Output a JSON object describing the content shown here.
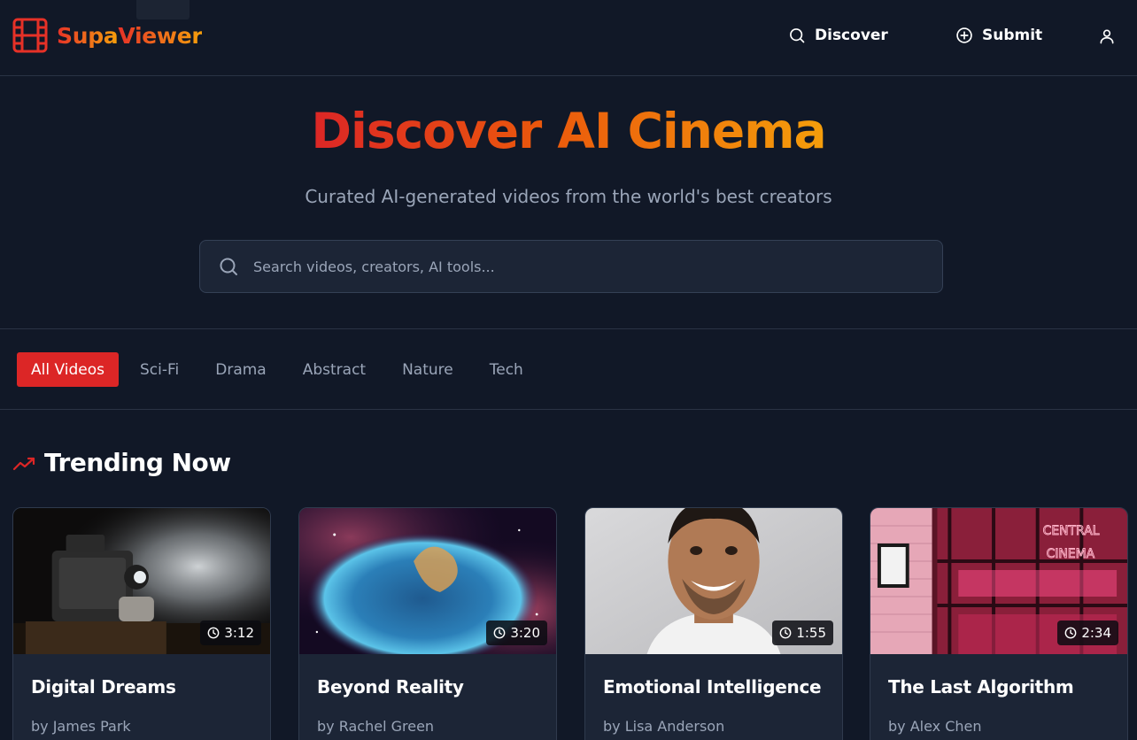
{
  "header": {
    "brand": "SupaViewer",
    "brand_prefix": "Supa",
    "brand_suffix": "Viewer",
    "nav": {
      "discover": "Discover",
      "submit": "Submit"
    },
    "icons": [
      "film-icon",
      "search-icon",
      "plus-circle-icon",
      "user-icon"
    ]
  },
  "hero": {
    "title": "Discover AI Cinema",
    "subtitle": "Curated AI-generated videos from the world's best creators",
    "search_placeholder": "Search videos, creators, AI tools..."
  },
  "filters": [
    {
      "label": "All Videos",
      "active": true
    },
    {
      "label": "Sci-Fi",
      "active": false
    },
    {
      "label": "Drama",
      "active": false
    },
    {
      "label": "Abstract",
      "active": false
    },
    {
      "label": "Nature",
      "active": false
    },
    {
      "label": "Tech",
      "active": false
    }
  ],
  "trending": {
    "heading": "Trending Now",
    "videos": [
      {
        "title": "Digital Dreams",
        "author": "by James Park",
        "duration": "3:12",
        "thumb": "film-projector"
      },
      {
        "title": "Beyond Reality",
        "author": "by Rachel Green",
        "duration": "3:20",
        "thumb": "nebula"
      },
      {
        "title": "Emotional Intelligence",
        "author": "by Lisa Anderson",
        "duration": "1:55",
        "thumb": "smiling-man-portrait"
      },
      {
        "title": "The Last Algorithm",
        "author": "by Alex Chen",
        "duration": "2:34",
        "thumb": "neon-cinema-storefront",
        "sign_text": "CENTRAL CINEMA"
      }
    ]
  },
  "colors": {
    "background": "#111827",
    "accent": "#dc2626",
    "accent_orange": "#f59e0b",
    "card": "#1c2536",
    "muted_text": "#9aa5b8"
  }
}
